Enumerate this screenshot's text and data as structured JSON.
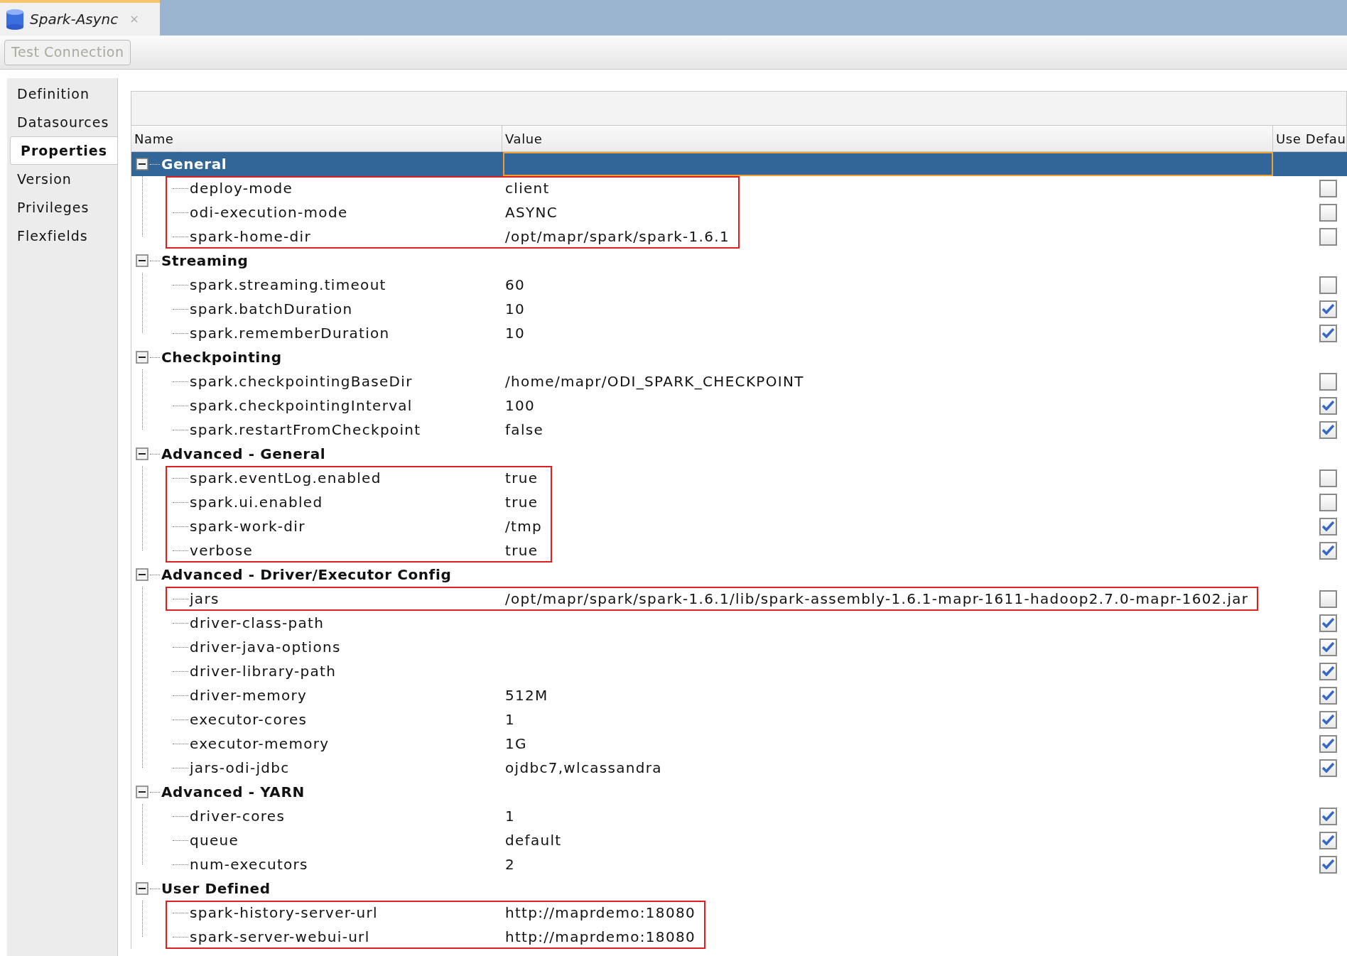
{
  "tab": {
    "title": "Spark-Async",
    "close": "×"
  },
  "toolbar": {
    "buttons": [
      {
        "label": "Test Connection",
        "disabled": true
      }
    ]
  },
  "sidebar": {
    "items": [
      {
        "label": "Definition",
        "selected": false
      },
      {
        "label": "Datasources",
        "selected": false
      },
      {
        "label": "Properties",
        "selected": true
      },
      {
        "label": "Version",
        "selected": false
      },
      {
        "label": "Privileges",
        "selected": false
      },
      {
        "label": "Flexfields",
        "selected": false
      }
    ]
  },
  "table": {
    "columns": [
      "Name",
      "Value",
      "Use Defau"
    ],
    "groups": [
      {
        "label": "General",
        "expanded": true,
        "selected": true,
        "blocks": [
          {
            "highlighted": true,
            "rows": [
              {
                "name": "deploy-mode",
                "value": "client",
                "use_default": false
              },
              {
                "name": "odi-execution-mode",
                "value": "ASYNC",
                "use_default": false
              },
              {
                "name": "spark-home-dir",
                "value": "/opt/mapr/spark/spark-1.6.1",
                "use_default": false
              }
            ]
          }
        ]
      },
      {
        "label": "Streaming",
        "expanded": true,
        "selected": false,
        "blocks": [
          {
            "highlighted": false,
            "rows": [
              {
                "name": "spark.streaming.timeout",
                "value": "60",
                "use_default": false
              },
              {
                "name": "spark.batchDuration",
                "value": "10",
                "use_default": true
              },
              {
                "name": "spark.rememberDuration",
                "value": "10",
                "use_default": true
              }
            ]
          }
        ]
      },
      {
        "label": "Checkpointing",
        "expanded": true,
        "selected": false,
        "blocks": [
          {
            "highlighted": false,
            "rows": [
              {
                "name": "spark.checkpointingBaseDir",
                "value": "/home/mapr/ODI_SPARK_CHECKPOINT",
                "use_default": false
              },
              {
                "name": "spark.checkpointingInterval",
                "value": "100",
                "use_default": true
              },
              {
                "name": "spark.restartFromCheckpoint",
                "value": "false",
                "use_default": true
              }
            ]
          }
        ]
      },
      {
        "label": "Advanced - General",
        "expanded": true,
        "selected": false,
        "blocks": [
          {
            "highlighted": true,
            "rows": [
              {
                "name": "spark.eventLog.enabled",
                "value": "true",
                "use_default": false
              },
              {
                "name": "spark.ui.enabled",
                "value": "true",
                "use_default": false
              },
              {
                "name": "spark-work-dir",
                "value": "/tmp",
                "use_default": true
              },
              {
                "name": "verbose",
                "value": "true",
                "use_default": true
              }
            ]
          }
        ]
      },
      {
        "label": "Advanced - Driver/Executor Config",
        "expanded": true,
        "selected": false,
        "blocks": [
          {
            "highlighted": true,
            "rows": [
              {
                "name": "jars",
                "value": "/opt/mapr/spark/spark-1.6.1/lib/spark-assembly-1.6.1-mapr-1611-hadoop2.7.0-mapr-1602.jar",
                "use_default": false
              }
            ]
          },
          {
            "highlighted": false,
            "rows": [
              {
                "name": "driver-class-path",
                "use_default": true
              },
              {
                "name": "driver-java-options",
                "use_default": true
              },
              {
                "name": "driver-library-path",
                "use_default": true
              },
              {
                "name": "driver-memory",
                "value": "512M",
                "use_default": true
              },
              {
                "name": "executor-cores",
                "value": "1",
                "use_default": true
              },
              {
                "name": "executor-memory",
                "value": "1G",
                "use_default": true
              },
              {
                "name": "jars-odi-jdbc",
                "value": "ojdbc7,wlcassandra",
                "use_default": true
              }
            ]
          }
        ]
      },
      {
        "label": "Advanced - YARN",
        "expanded": true,
        "selected": false,
        "blocks": [
          {
            "highlighted": false,
            "rows": [
              {
                "name": "driver-cores",
                "value": "1",
                "use_default": true
              },
              {
                "name": "queue",
                "value": "default",
                "use_default": true
              },
              {
                "name": "num-executors",
                "value": "2",
                "use_default": true
              }
            ]
          }
        ]
      },
      {
        "label": "User Defined",
        "expanded": true,
        "selected": false,
        "blocks": [
          {
            "highlighted": true,
            "rows": [
              {
                "name": "spark-history-server-url",
                "value": "http://maprdemo:18080"
              },
              {
                "name": "spark-server-webui-url",
                "value": "http://maprdemo:18080"
              }
            ]
          }
        ]
      }
    ]
  }
}
